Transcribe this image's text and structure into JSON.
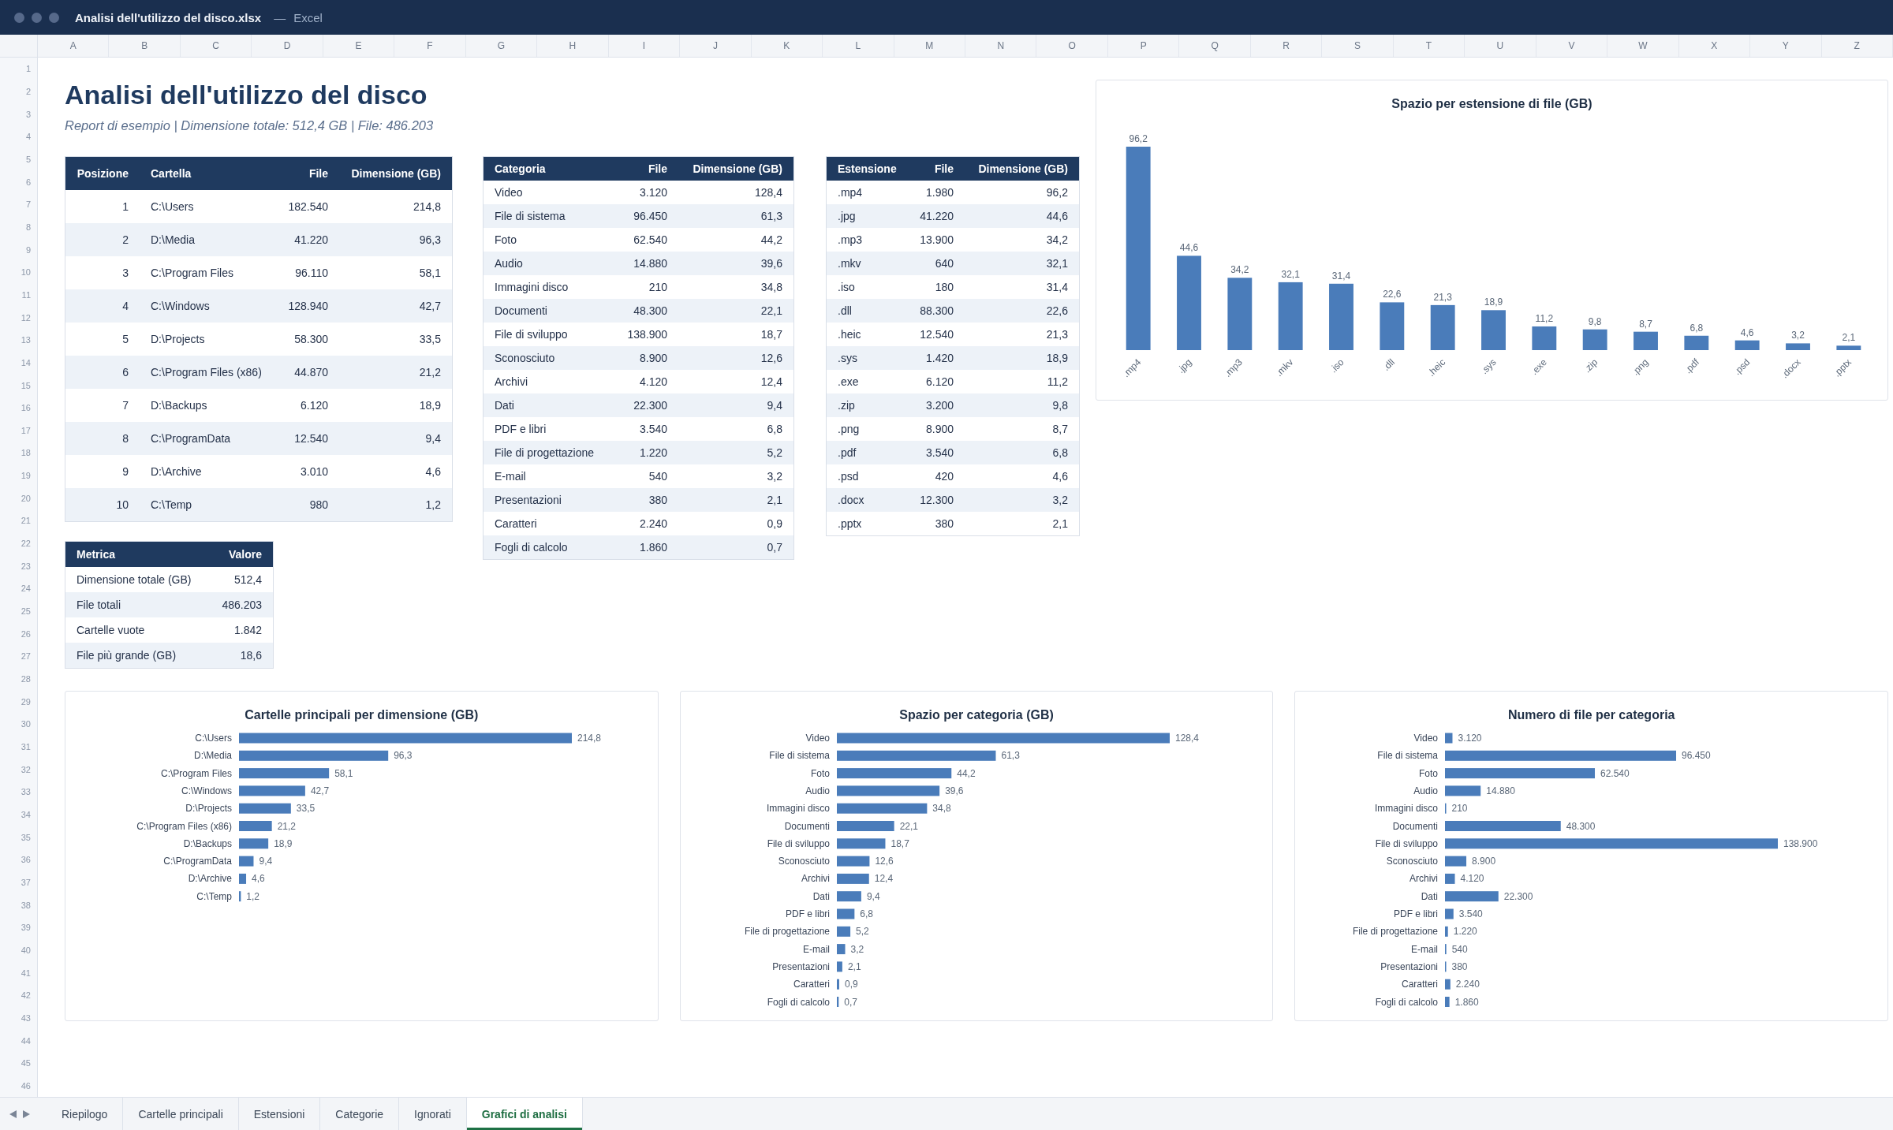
{
  "window": {
    "title": "Analisi dell'utilizzo del disco.xlsx",
    "separator": "—",
    "app": "Excel"
  },
  "column_headers": [
    "A",
    "B",
    "C",
    "D",
    "E",
    "F",
    "G",
    "H",
    "I",
    "J",
    "K",
    "L",
    "M",
    "N",
    "O",
    "P",
    "Q",
    "R",
    "S",
    "T",
    "U",
    "V",
    "W",
    "X",
    "Y",
    "Z"
  ],
  "row_headers": [
    "1",
    "2",
    "3",
    "4",
    "5",
    "6",
    "7",
    "8",
    "9",
    "10",
    "11",
    "12",
    "13",
    "14",
    "15",
    "16",
    "17",
    "18",
    "19",
    "20",
    "21",
    "22",
    "23",
    "24",
    "25",
    "26",
    "27",
    "28",
    "29",
    "30",
    "31",
    "32",
    "33",
    "34",
    "35",
    "36",
    "37",
    "38",
    "39",
    "40",
    "41",
    "42",
    "43",
    "44",
    "45",
    "46"
  ],
  "sheet": {
    "title": "Analisi dell'utilizzo del disco",
    "subtitle": "Report di esempio | Dimensione totale: 512,4 GB | File: 486.203"
  },
  "top_folders_table": {
    "columns": [
      {
        "label": "Posizione",
        "kind": "number"
      },
      {
        "label": "Cartella",
        "kind": "text"
      },
      {
        "label": "File",
        "kind": "number"
      },
      {
        "label": "Dimensione (GB)",
        "kind": "number"
      }
    ],
    "rows": [
      [
        "1",
        "C:\\Users",
        "182.540",
        "214,8"
      ],
      [
        "2",
        "D:\\Media",
        "41.220",
        "96,3"
      ],
      [
        "3",
        "C:\\Program Files",
        "96.110",
        "58,1"
      ],
      [
        "4",
        "C:\\Windows",
        "128.940",
        "42,7"
      ],
      [
        "5",
        "D:\\Projects",
        "58.300",
        "33,5"
      ],
      [
        "6",
        "C:\\Program Files (x86)",
        "44.870",
        "21,2"
      ],
      [
        "7",
        "D:\\Backups",
        "6.120",
        "18,9"
      ],
      [
        "8",
        "C:\\ProgramData",
        "12.540",
        "9,4"
      ],
      [
        "9",
        "D:\\Archive",
        "3.010",
        "4,6"
      ],
      [
        "10",
        "C:\\Temp",
        "980",
        "1,2"
      ]
    ]
  },
  "summary_table": {
    "columns": [
      {
        "label": "Metrica",
        "kind": "text"
      },
      {
        "label": "Valore",
        "kind": "number"
      }
    ],
    "rows": [
      [
        "Dimensione totale (GB)",
        "512,4"
      ],
      [
        "File totali",
        "486.203"
      ],
      [
        "Cartelle vuote",
        "1.842"
      ],
      [
        "File più grande (GB)",
        "18,6"
      ]
    ]
  },
  "categories_table": {
    "columns": [
      {
        "label": "Categoria",
        "kind": "text"
      },
      {
        "label": "File",
        "kind": "number"
      },
      {
        "label": "Dimensione (GB)",
        "kind": "number"
      }
    ],
    "rows": [
      [
        "Video",
        "3.120",
        "128,4"
      ],
      [
        "File di sistema",
        "96.450",
        "61,3"
      ],
      [
        "Foto",
        "62.540",
        "44,2"
      ],
      [
        "Audio",
        "14.880",
        "39,6"
      ],
      [
        "Immagini disco",
        "210",
        "34,8"
      ],
      [
        "Documenti",
        "48.300",
        "22,1"
      ],
      [
        "File di sviluppo",
        "138.900",
        "18,7"
      ],
      [
        "Sconosciuto",
        "8.900",
        "12,6"
      ],
      [
        "Archivi",
        "4.120",
        "12,4"
      ],
      [
        "Dati",
        "22.300",
        "9,4"
      ],
      [
        "PDF e libri",
        "3.540",
        "6,8"
      ],
      [
        "File di progettazione",
        "1.220",
        "5,2"
      ],
      [
        "E-mail",
        "540",
        "3,2"
      ],
      [
        "Presentazioni",
        "380",
        "2,1"
      ],
      [
        "Caratteri",
        "2.240",
        "0,9"
      ],
      [
        "Fogli di calcolo",
        "1.860",
        "0,7"
      ]
    ]
  },
  "extensions_table": {
    "columns": [
      {
        "label": "Estensione",
        "kind": "text"
      },
      {
        "label": "File",
        "kind": "number"
      },
      {
        "label": "Dimensione (GB)",
        "kind": "number"
      }
    ],
    "rows": [
      [
        ".mp4",
        "1.980",
        "96,2"
      ],
      [
        ".jpg",
        "41.220",
        "44,6"
      ],
      [
        ".mp3",
        "13.900",
        "34,2"
      ],
      [
        ".mkv",
        "640",
        "32,1"
      ],
      [
        ".iso",
        "180",
        "31,4"
      ],
      [
        ".dll",
        "88.300",
        "22,6"
      ],
      [
        ".heic",
        "12.540",
        "21,3"
      ],
      [
        ".sys",
        "1.420",
        "18,9"
      ],
      [
        ".exe",
        "6.120",
        "11,2"
      ],
      [
        ".zip",
        "3.200",
        "9,8"
      ],
      [
        ".png",
        "8.900",
        "8,7"
      ],
      [
        ".pdf",
        "3.540",
        "6,8"
      ],
      [
        ".psd",
        "420",
        "4,6"
      ],
      [
        ".docx",
        "12.300",
        "3,2"
      ],
      [
        ".pptx",
        "380",
        "2,1"
      ]
    ]
  },
  "extension_chart": {
    "chart_data": {
      "type": "bar",
      "orientation": "vertical",
      "title": "Spazio per estensione di file (GB)",
      "categories": [
        ".mp4",
        ".jpg",
        ".mp3",
        ".mkv",
        ".iso",
        ".dll",
        ".heic",
        ".sys",
        ".exe",
        ".zip",
        ".png",
        ".pdf",
        ".psd",
        ".docx",
        ".pptx"
      ],
      "values": [
        96.2,
        44.6,
        34.2,
        32.1,
        31.4,
        22.6,
        21.3,
        18.9,
        11.2,
        9.8,
        8.7,
        6.8,
        4.6,
        3.2,
        2.1
      ],
      "value_labels": [
        "96,2",
        "44,6",
        "34,2",
        "32,1",
        "31,4",
        "22,6",
        "21,3",
        "18,9",
        "11,2",
        "9,8",
        "8,7",
        "6,8",
        "4,6",
        "3,2",
        "2,1"
      ]
    }
  },
  "bottom_charts": [
    {
      "chart_data": {
        "type": "bar",
        "orientation": "horizontal",
        "title": "Cartelle principali per dimensione (GB)",
        "categories": [
          "C:\\Users",
          "D:\\Media",
          "C:\\Program Files",
          "C:\\Windows",
          "D:\\Projects",
          "C:\\Program Files (x86)",
          "D:\\Backups",
          "C:\\ProgramData",
          "D:\\Archive",
          "C:\\Temp"
        ],
        "values": [
          214.8,
          96.3,
          58.1,
          42.7,
          33.5,
          21.2,
          18.9,
          9.4,
          4.6,
          1.2
        ],
        "value_labels": [
          "214,8",
          "96,3",
          "58,1",
          "42,7",
          "33,5",
          "21,2",
          "18,9",
          "9,4",
          "4,6",
          "1,2"
        ]
      }
    },
    {
      "chart_data": {
        "type": "bar",
        "orientation": "horizontal",
        "title": "Spazio per categoria (GB)",
        "categories": [
          "Video",
          "File di sistema",
          "Foto",
          "Audio",
          "Immagini disco",
          "Documenti",
          "File di sviluppo",
          "Sconosciuto",
          "Archivi",
          "Dati",
          "PDF e libri",
          "File di progettazione",
          "E-mail",
          "Presentazioni",
          "Caratteri",
          "Fogli di calcolo"
        ],
        "values": [
          128.4,
          61.3,
          44.2,
          39.6,
          34.8,
          22.1,
          18.7,
          12.6,
          12.4,
          9.4,
          6.8,
          5.2,
          3.2,
          2.1,
          0.9,
          0.7
        ],
        "value_labels": [
          "128,4",
          "61,3",
          "44,2",
          "39,6",
          "34,8",
          "22,1",
          "18,7",
          "12,6",
          "12,4",
          "9,4",
          "6,8",
          "5,2",
          "3,2",
          "2,1",
          "0,9",
          "0,7"
        ]
      }
    },
    {
      "chart_data": {
        "type": "bar",
        "orientation": "horizontal",
        "title": "Numero di file per categoria",
        "categories": [
          "Video",
          "File di sistema",
          "Foto",
          "Audio",
          "Immagini disco",
          "Documenti",
          "File di sviluppo",
          "Sconosciuto",
          "Archivi",
          "Dati",
          "PDF e libri",
          "File di progettazione",
          "E-mail",
          "Presentazioni",
          "Caratteri",
          "Fogli di calcolo"
        ],
        "values": [
          3120,
          96450,
          62540,
          14880,
          210,
          48300,
          138900,
          8900,
          4120,
          22300,
          3540,
          1220,
          540,
          380,
          2240,
          1860
        ],
        "value_labels": [
          "3.120",
          "96.450",
          "62.540",
          "14.880",
          "210",
          "48.300",
          "138.900",
          "8.900",
          "4.120",
          "22.300",
          "3.540",
          "1.220",
          "540",
          "380",
          "2.240",
          "1.860"
        ]
      }
    }
  ],
  "tabs": [
    {
      "label": "Riepilogo",
      "selected": false
    },
    {
      "label": "Cartelle principali",
      "selected": false
    },
    {
      "label": "Estensioni",
      "selected": false
    },
    {
      "label": "Categorie",
      "selected": false
    },
    {
      "label": "Ignorati",
      "selected": false
    },
    {
      "label": "Grafici di analisi",
      "selected": true
    }
  ]
}
